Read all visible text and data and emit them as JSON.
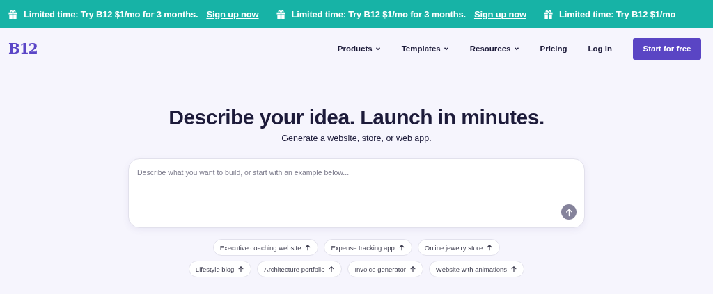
{
  "promo_banner": [
    {
      "text": "Limited time: Try B12 $1/mo for 3 months.",
      "link": "Sign up now"
    },
    {
      "text": "Limited time: Try B12 $1/mo for 3 months.",
      "link": "Sign up now"
    },
    {
      "text": "Limited time: Try B12 $1/mo"
    }
  ],
  "nav": {
    "logo": "B12",
    "items": [
      {
        "label": "Products",
        "dropdown": true
      },
      {
        "label": "Templates",
        "dropdown": true
      },
      {
        "label": "Resources",
        "dropdown": true
      },
      {
        "label": "Pricing",
        "dropdown": false
      },
      {
        "label": "Log in",
        "dropdown": false
      }
    ],
    "cta": "Start for free"
  },
  "hero": {
    "title": "Describe your idea. Launch in minutes.",
    "subtitle": "Generate a website, store, or web app.",
    "prompt": {
      "placeholder": "Describe what you want to build, or start with an example below..."
    },
    "examples": [
      [
        "Executive coaching website",
        "Expense tracking app",
        "Online jewelry store"
      ],
      [
        "Lifestyle blog",
        "Architecture portfolio",
        "Invoice generator",
        "Website with animations"
      ]
    ]
  }
}
